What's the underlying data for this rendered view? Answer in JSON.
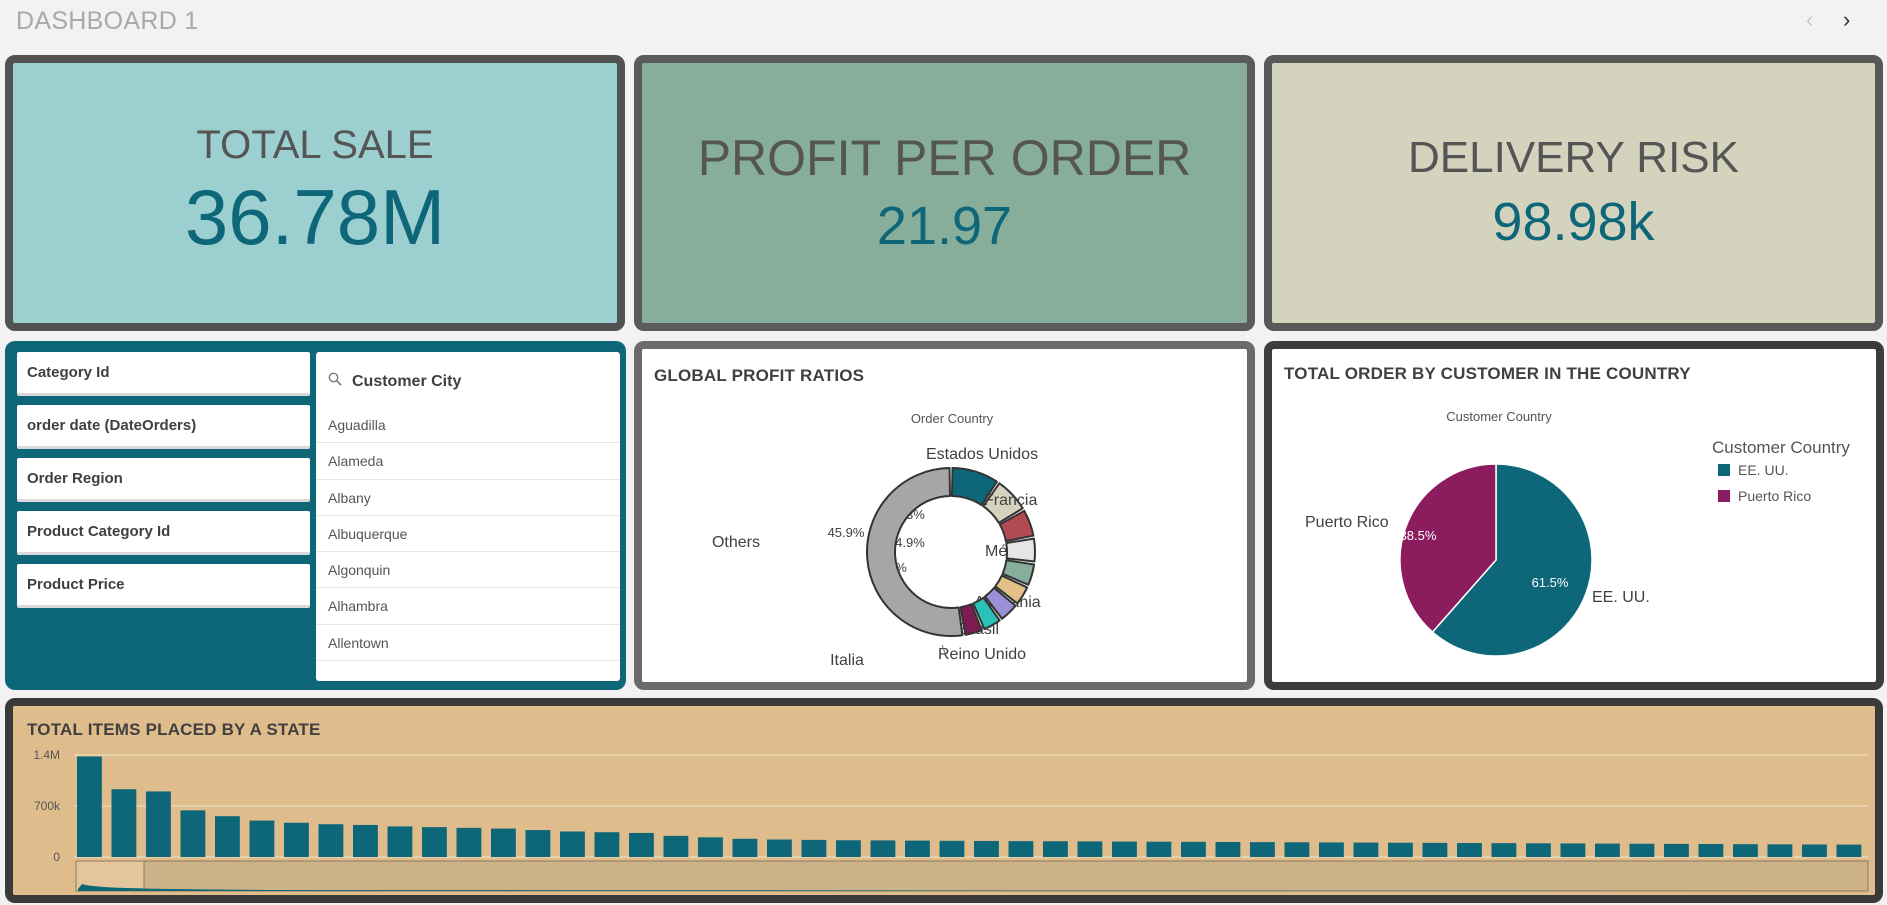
{
  "header": {
    "title": "DASHBOARD 1",
    "prev_icon": "‹",
    "next_icon": "›"
  },
  "kpis": {
    "total_sale": {
      "label": "TOTAL SALE",
      "value": "36.78M"
    },
    "profit_per_order": {
      "label": "PROFIT PER ORDER",
      "value": "21.97"
    },
    "delivery_risk": {
      "label": "DELIVERY RISK",
      "value": "98.98k"
    }
  },
  "filters": {
    "items": [
      "Category Id",
      "order date (DateOrders)",
      "Order Region",
      "Product Category Id",
      "Product Price"
    ],
    "city_list": {
      "title": "Customer City",
      "search_icon": "search-icon",
      "items": [
        "Aguadilla",
        "Alameda",
        "Albany",
        "Albuquerque",
        "Algonquin",
        "Alhambra",
        "Allentown"
      ]
    }
  },
  "colors": {
    "accent": "#0e6679",
    "magenta": "#8b1d5f",
    "panel_tan": "#dfbc8c"
  },
  "chart_data": [
    {
      "type": "pie",
      "title": "GLOBAL PROFIT RATIOS",
      "subtitle": "Order Country",
      "donut": true,
      "slices": [
        {
          "label": "Estados Unidos",
          "value": 8.3,
          "pct_label": "8.3%",
          "color": "#0e6679"
        },
        {
          "label": "Francia",
          "value": 6.2,
          "pct_label": "",
          "color": "#d4d3be"
        },
        {
          "label": "México",
          "value": 4.9,
          "pct_label": "4.9%",
          "color": "#b24a52"
        },
        {
          "label": "Alemania",
          "value": 4.3,
          "pct_label": "4.3%",
          "color": "#e8e6e4"
        },
        {
          "label": "Brasil",
          "value": 4.0,
          "pct_label": "",
          "color": "#86ae9b"
        },
        {
          "label": "Reino Unido",
          "value": 3.6,
          "pct_label": "",
          "color": "#e3c08a"
        },
        {
          "label": "",
          "value": 3.6,
          "pct_label": "",
          "color": "#9b8fd6"
        },
        {
          "label": "",
          "value": 3.4,
          "pct_label": "",
          "color": "#2bc0b8"
        },
        {
          "label": "Italia",
          "value": 3.3,
          "pct_label": "",
          "color": "#7d1c52"
        },
        {
          "label": "Others",
          "value": 45.9,
          "pct_label": "45.9%",
          "color": "#a6a6a6"
        }
      ]
    },
    {
      "type": "pie",
      "title": "TOTAL ORDER BY CUSTOMER IN THE COUNTRY",
      "subtitle": "Customer Country",
      "legend_title": "Customer Country",
      "legend_position": "right",
      "slices": [
        {
          "label": "EE. UU.",
          "value": 61.5,
          "pct_label": "61.5%",
          "color": "#0e6679"
        },
        {
          "label": "Puerto Rico",
          "value": 38.5,
          "pct_label": "38.5%",
          "color": "#8b1d5f"
        }
      ]
    },
    {
      "type": "bar",
      "title": "TOTAL ITEMS PLACED BY A STATE",
      "yticks": [
        "1.4M",
        "700k",
        "0"
      ],
      "ylim": [
        0,
        1400000
      ],
      "grid": true,
      "values": [
        1380000,
        930000,
        900000,
        640000,
        560000,
        500000,
        470000,
        450000,
        440000,
        420000,
        410000,
        400000,
        390000,
        370000,
        350000,
        340000,
        330000,
        290000,
        270000,
        250000,
        240000,
        235000,
        230000,
        228000,
        225000,
        222000,
        220000,
        218000,
        216000,
        214000,
        212000,
        210000,
        208000,
        206000,
        204000,
        202000,
        200000,
        198000,
        196000,
        194000,
        192000,
        190000,
        188000,
        186000,
        184000,
        182000,
        180000,
        178000,
        176000,
        174000,
        172000,
        170000
      ]
    }
  ]
}
